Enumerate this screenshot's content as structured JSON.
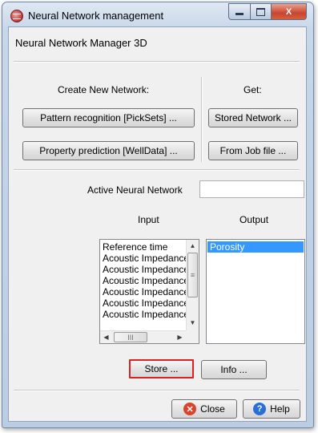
{
  "window": {
    "title": "Neural Network management",
    "minimize_glyph": "",
    "close_glyph": "X"
  },
  "header": {
    "title": "Neural Network Manager 3D"
  },
  "create_section": {
    "label": "Create New Network:",
    "pattern_button": "Pattern recognition [PickSets] ...",
    "property_button": "Property prediction [WellData] ..."
  },
  "get_section": {
    "label": "Get:",
    "stored_button": "Stored Network ...",
    "job_button": "From Job file ..."
  },
  "active_network": {
    "label": "Active Neural Network",
    "value": ""
  },
  "input": {
    "label": "Input",
    "items": [
      "Reference time",
      "Acoustic Impedance",
      "Acoustic Impedance",
      "Acoustic Impedance",
      "Acoustic Impedance",
      "Acoustic Impedance",
      "Acoustic Impedance"
    ],
    "scroll_thumb_glyph": "III"
  },
  "output": {
    "label": "Output",
    "items": [
      "Porosity"
    ],
    "selected_index": 0
  },
  "actions": {
    "store_button": "Store ...",
    "info_button": "Info ..."
  },
  "footer": {
    "close_button": "Close",
    "help_button": "Help"
  },
  "colors": {
    "store_highlight": "#e02020",
    "list_selection": "#3399ff",
    "close_icon": "#d9432c",
    "help_icon": "#2a6fd6"
  },
  "icons": {
    "app": "neural-network-app-icon",
    "close": "close-icon",
    "help": "help-icon"
  }
}
